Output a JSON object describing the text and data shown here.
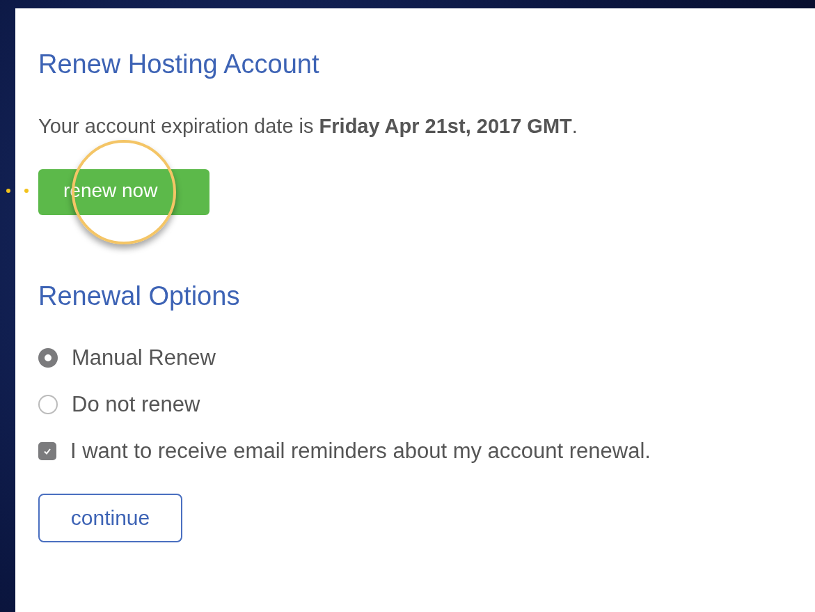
{
  "title": "Renew Hosting Account",
  "expiration_text": "Your account expiration date is **Friday Apr 21st, 2017 GMT**.",
  "renew_button": "renew now",
  "options_heading": "Renewal Options",
  "options": [
    {
      "kind": "radio",
      "label": "Manual Renew",
      "selected": true
    },
    {
      "kind": "radio",
      "label": "Do not renew",
      "selected": false
    },
    {
      "kind": "checkbox",
      "label": "I want to receive email reminders about my account renewal.",
      "checked": true
    }
  ],
  "continue_button": "continue"
}
